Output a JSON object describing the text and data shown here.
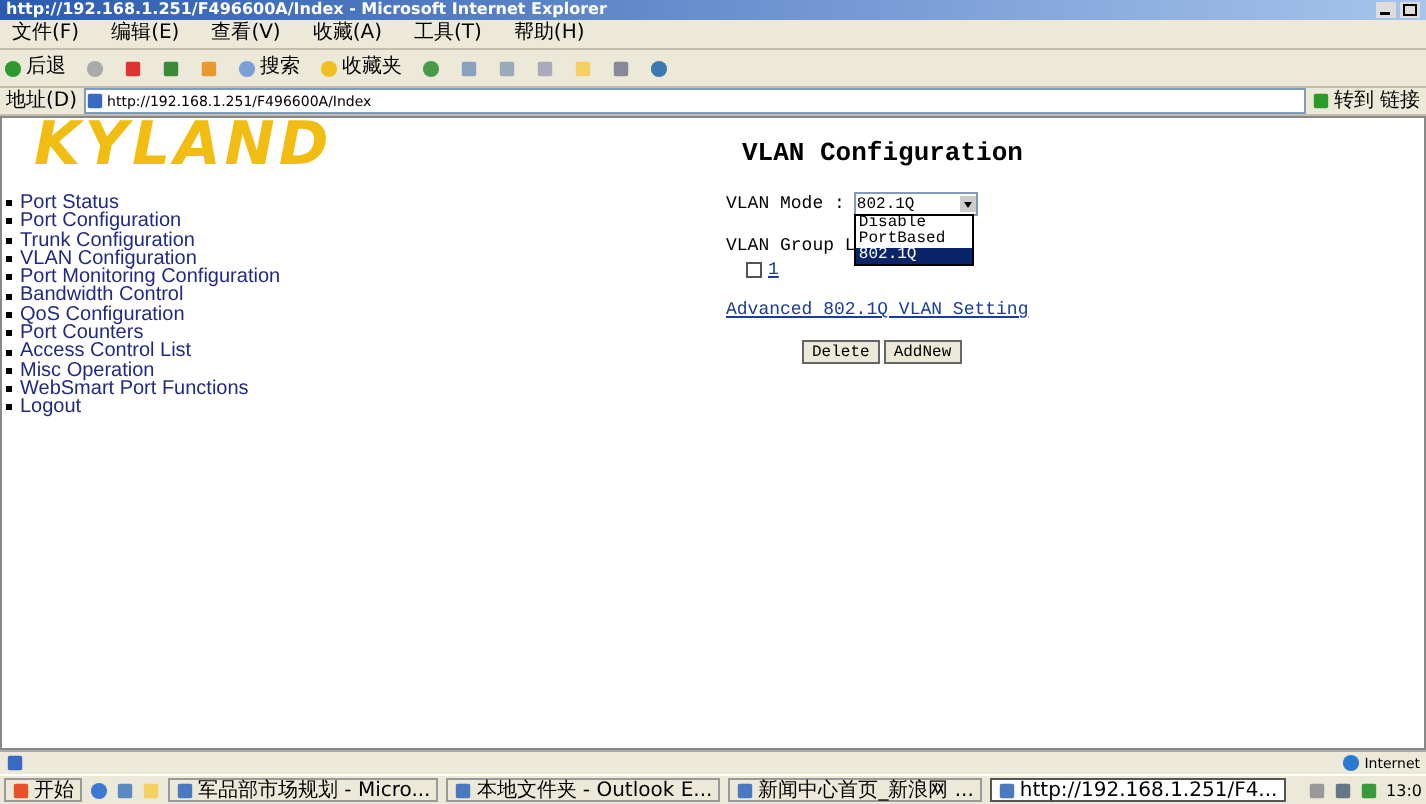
{
  "window": {
    "title": "http://192.168.1.251/F496600A/Index - Microsoft Internet Explorer"
  },
  "menu": [
    "文件(F)",
    "编辑(E)",
    "查看(V)",
    "收藏(A)",
    "工具(T)",
    "帮助(H)"
  ],
  "toolbar": {
    "back": "后退",
    "search": "搜索",
    "favorites": "收藏夹"
  },
  "address": {
    "label": "地址(D)",
    "value": "http://192.168.1.251/F496600A/Index",
    "go": "转到",
    "links": "链接"
  },
  "logo": "KYLAND",
  "nav": [
    "Port Status",
    "Port Configuration",
    "Trunk Configuration",
    "VLAN Configuration",
    "Port Monitoring Configuration",
    "Bandwidth Control",
    "QoS Configuration",
    "Port Counters",
    "Access Control List",
    "Misc Operation",
    "WebSmart Port Functions",
    "Logout"
  ],
  "page": {
    "heading": "VLAN Configuration",
    "mode_label": "VLAN Mode :",
    "mode_value": "802.1Q",
    "options": [
      {
        "label": "Disable",
        "selected": false
      },
      {
        "label": "PortBased",
        "selected": false
      },
      {
        "label": "802.1Q",
        "selected": true
      }
    ],
    "group_label": "VLAN Group L",
    "groups": [
      {
        "label": "1",
        "checked": false
      }
    ],
    "advanced_link": "Advanced 802.1Q VLAN Setting",
    "buttons": [
      "Delete",
      "AddNew"
    ]
  },
  "status_bar": {
    "zone": "Internet"
  },
  "taskbar": {
    "start": "开始",
    "tasks": [
      {
        "label": "军品部市场规划 - Micro...",
        "selected": false
      },
      {
        "label": "本地文件夹 - Outlook E...",
        "selected": false
      },
      {
        "label": "新闻中心首页_新浪网 ...",
        "selected": false
      },
      {
        "label": "http://192.168.1.251/F4...",
        "selected": true
      }
    ],
    "clock": "13:0"
  }
}
